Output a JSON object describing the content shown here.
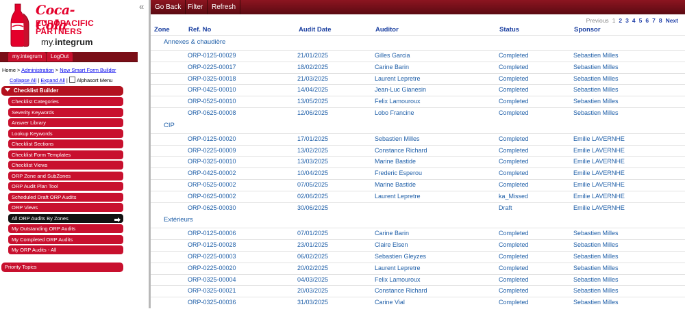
{
  "brand": {
    "logo_line1": "Coca-Cola",
    "logo_line2": "EUROPACIFIC",
    "logo_line3": "PARTNERS",
    "logo_sub_pre": "my.",
    "logo_sub": "integrum",
    "red": "#c8102e"
  },
  "topnav": {
    "my_integrum": "my.integrum",
    "logout": "LogOut"
  },
  "breadcrumb": {
    "home": "Home >",
    "admin": "Administration",
    "sep": ">",
    "current": "New Smart Form Builder"
  },
  "tree_controls": {
    "collapse": "Collapse All",
    "sep": "|",
    "expand": "Expand All",
    "sep2": "|",
    "alphasort": "Alphasort Menu"
  },
  "sidebar": {
    "section": "Checklist Builder",
    "items": [
      "Checklist Categories",
      "Severity Keywords",
      "Answer Library",
      "Lookup Keywords",
      "Checklist Sections",
      "Checklist Form Templates",
      "Checklist Views",
      "ORP Zone and SubZones",
      "ORP Audit Plan Tool",
      "Scheduled Draft ORP Audits",
      "ORP Views",
      "All ORP Audits By Zones",
      "My Outstanding ORP Audits",
      "My Completed ORP Audits",
      "My ORP Audits - All"
    ],
    "priority": "Priority Topics"
  },
  "collapse_icon": "«",
  "toolbar": {
    "go_back": "Go Back",
    "filter": "Filter",
    "refresh": "Refresh"
  },
  "pager": {
    "previous": "Previous",
    "pages": [
      "1",
      "2",
      "3",
      "4",
      "5",
      "6",
      "7",
      "8"
    ],
    "current": "1",
    "next": "Next"
  },
  "columns": {
    "zone": "Zone",
    "ref": "Ref. No",
    "date": "Audit Date",
    "auditor": "Auditor",
    "status": "Status",
    "sponsor": "Sponsor"
  },
  "groups": [
    {
      "name": "Annexes & chaudière",
      "rows": [
        [
          "ORP-0125-00029",
          "21/01/2025",
          "Gilles Garcia",
          "Completed",
          "Sebastien Milles"
        ],
        [
          "ORP-0225-00017",
          "18/02/2025",
          "Carine Barin",
          "Completed",
          "Sebastien Milles"
        ],
        [
          "ORP-0325-00018",
          "21/03/2025",
          "Laurent Lepretre",
          "Completed",
          "Sebastien Milles"
        ],
        [
          "ORP-0425-00010",
          "14/04/2025",
          "Jean-Luc Gianesin",
          "Completed",
          "Sebastien Milles"
        ],
        [
          "ORP-0525-00010",
          "13/05/2025",
          "Felix Lamouroux",
          "Completed",
          "Sebastien Milles"
        ],
        [
          "ORP-0625-00008",
          "12/06/2025",
          "Lobo Francine",
          "Completed",
          "Sebastien Milles"
        ]
      ]
    },
    {
      "name": "CIP",
      "rows": [
        [
          "ORP-0125-00020",
          "17/01/2025",
          "Sebastien Milles",
          "Completed",
          "Emilie LAVERNHE"
        ],
        [
          "ORP-0225-00009",
          "13/02/2025",
          "Constance Richard",
          "Completed",
          "Emilie LAVERNHE"
        ],
        [
          "ORP-0325-00010",
          "13/03/2025",
          "Marine Bastide",
          "Completed",
          "Emilie LAVERNHE"
        ],
        [
          "ORP-0425-00002",
          "10/04/2025",
          "Frederic Esperou",
          "Completed",
          "Emilie LAVERNHE"
        ],
        [
          "ORP-0525-00002",
          "07/05/2025",
          "Marine Bastide",
          "Completed",
          "Emilie LAVERNHE"
        ],
        [
          "ORP-0625-00002",
          "02/06/2025",
          "Laurent Lepretre",
          "ka_Missed",
          "Emilie LAVERNHE"
        ],
        [
          "ORP-0625-00030",
          "30/06/2025",
          "",
          "Draft",
          "Emilie LAVERNHE"
        ]
      ]
    },
    {
      "name": "Extérieurs",
      "rows": [
        [
          "ORP-0125-00006",
          "07/01/2025",
          "Carine Barin",
          "Completed",
          "Sebastien Milles"
        ],
        [
          "ORP-0125-00028",
          "23/01/2025",
          "Claire Elsen",
          "Completed",
          "Sebastien Milles"
        ],
        [
          "ORP-0225-00003",
          "06/02/2025",
          "Sebastien Gleyzes",
          "Completed",
          "Sebastien Milles"
        ],
        [
          "ORP-0225-00020",
          "20/02/2025",
          "Laurent Lepretre",
          "Completed",
          "Sebastien Milles"
        ],
        [
          "ORP-0325-00004",
          "04/03/2025",
          "Felix Lamouroux",
          "Completed",
          "Sebastien Milles"
        ],
        [
          "ORP-0325-00021",
          "20/03/2025",
          "Constance Richard",
          "Completed",
          "Sebastien Milles"
        ],
        [
          "ORP-0325-00036",
          "31/03/2025",
          "Carine Vial",
          "Completed",
          "Sebastien Milles"
        ]
      ]
    }
  ]
}
